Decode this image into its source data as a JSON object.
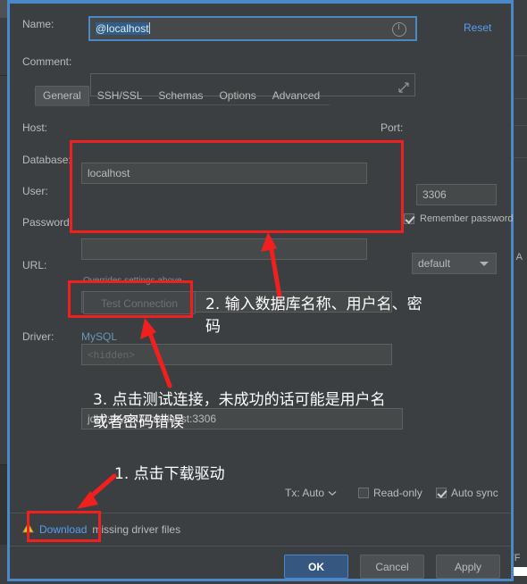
{
  "dialog": {
    "name_label": "Name:",
    "name_value": "@localhost",
    "name_selected_part": "@localhost",
    "name_reset_icon": "refresh-circle-icon",
    "reset_link": "Reset",
    "comment_label": "Comment:",
    "comment_value": "",
    "comment_expand_icon": "expand-arrow-icon",
    "tabs": [
      {
        "label": "General",
        "active": true
      },
      {
        "label": "SSH/SSL",
        "active": false
      },
      {
        "label": "Schemas",
        "active": false
      },
      {
        "label": "Options",
        "active": false
      },
      {
        "label": "Advanced",
        "active": false
      }
    ],
    "host_label": "Host:",
    "host_value": "localhost",
    "port_label": "Port:",
    "port_value": "3306",
    "database_label": "Database:",
    "database_value": "",
    "user_label": "User:",
    "user_value": "",
    "password_label": "Password:",
    "password_placeholder": "<hidden>",
    "remember_password_label": "Remember password",
    "remember_password_checked": true,
    "url_label": "URL:",
    "url_value": "jdbc:mysql://localhost:3306",
    "url_hint": "Overrides settings above",
    "scheme_value": "default",
    "test_connection_label": "Test Connection",
    "driver_label": "Driver:",
    "driver_value": "MySQL",
    "tx_label": "Tx: Auto",
    "tx_caret_icon": "chevron-down-icon",
    "read_only_label": "Read-only",
    "read_only_checked": false,
    "auto_sync_label": "Auto sync",
    "auto_sync_checked": true,
    "warning_icon": "warning-triangle-icon",
    "download_link": "Download",
    "missing_driver_text": "missing driver files",
    "ok_label": "OK",
    "cancel_label": "Cancel",
    "apply_label": "Apply"
  },
  "annotations": {
    "note1": "1. 点击下载驱动",
    "note2": "2. 输入数据库名称、用户名、密\n码",
    "note3": "3. 点击测试连接，未成功的话可能是用户名\n或者密码错误",
    "color": "#f21f1f"
  },
  "background": {
    "right_text_a": "n A",
    "right_text_b": "TF"
  },
  "colors": {
    "dialog_bg": "#3c3f41",
    "field_bg": "#45494a",
    "accent_blue": "#4a88c7",
    "link_blue": "#6897bb",
    "annotation_red": "#f21f1f",
    "primary_button": "#365880"
  }
}
